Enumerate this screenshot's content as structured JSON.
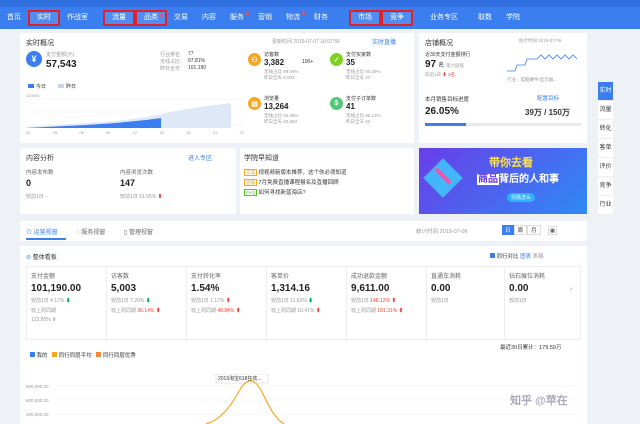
{
  "nav": {
    "items": [
      "首页",
      "实时",
      "作战室",
      "流量",
      "品类",
      "交易",
      "内容",
      "服务",
      "营销",
      "物流",
      "财务",
      "市场",
      "竞争",
      "业务专区",
      "取数",
      "学院"
    ]
  },
  "realtime": {
    "title": "实时概况",
    "update": "更新时间 2019-07-07 16:07:58",
    "link": "实时直播",
    "pay_label": "支付金额(元)",
    "pay_value": "57,543",
    "rank_label": "行业排名",
    "rank_value": "77",
    "ratio_label": "无线占比",
    "ratio_value": "97.81%",
    "yday_label": "昨日全天",
    "yday_value": "101,190",
    "legend_today": "今日",
    "legend_yday": "昨日",
    "y_top": "120000",
    "x_ticks": [
      "00",
      "03",
      "06",
      "09",
      "12",
      "15",
      "18",
      "21",
      "23"
    ],
    "metrics": [
      {
        "label": "访客数",
        "value": "3,382",
        "rank": "100+",
        "ratio_label": "无线占比",
        "ratio": "89.59%",
        "yday_label": "昨日全天",
        "yday": "5,003",
        "icon": "visitor-icon",
        "color": "#f5a623",
        "glyph": "⚇"
      },
      {
        "label": "支付买家数",
        "value": "35",
        "rank": "",
        "ratio_label": "无线占比",
        "ratio": "94.29%",
        "yday_label": "昨日全天",
        "yday": "47",
        "icon": "buyer-icon",
        "color": "#7ed321",
        "glyph": "✓"
      },
      {
        "label": "浏览量",
        "value": "13,264",
        "rank": "",
        "ratio_label": "无线占比",
        "ratio": "94.35%",
        "yday_label": "昨日全天",
        "yday": "20,663",
        "icon": "pageview-icon",
        "color": "#f5a623",
        "glyph": "▤"
      },
      {
        "label": "支付子订单数",
        "value": "41",
        "rank": "",
        "ratio_label": "无线占比",
        "ratio": "95.12%",
        "yday_label": "昨日全天",
        "yday": "52",
        "icon": "order-icon",
        "color": "#50c878",
        "glyph": "$"
      }
    ]
  },
  "shop": {
    "title": "店铺概况",
    "stat_time": "统计时间 2019-07-06",
    "rank_label": "近30天支付金额排行",
    "rank_value": "97",
    "rank_unit": "名",
    "rank_sub": "第六层级",
    "rank_change_label": "较前1日",
    "rank_change": "2名",
    "industry_label": "行业：电脑硬件/显示器...",
    "goal_label": "本月销售目标进度",
    "goal_link": "配置目标",
    "goal_pct": "26.05%",
    "goal_progress": 0.2605,
    "goal_amount": "39万 / 150万"
  },
  "content": {
    "title": "内容分析",
    "link": "进入专区",
    "posts_label": "内容发布数",
    "posts_value": "0",
    "posts_change_label": "较前1日",
    "posts_change": "-",
    "browse_label": "内容浏览次数",
    "browse_value": "147",
    "browse_change_label": "较前1日",
    "browse_change": "51.55%"
  },
  "academy": {
    "title": "学院早知道",
    "items": [
      {
        "tag": "实操",
        "text": "视视频新版本推荐，这个你必须知道"
      },
      {
        "tag": "直播",
        "text": "7月免费直播课程报名及直播回顾"
      },
      {
        "tag": "FAQ",
        "text": "如何寻找新蓝海店?"
      }
    ]
  },
  "banner": {
    "line1": "带你去看",
    "line2a": "商品",
    "line2b": "背后的人和事",
    "btn": "你猜怎么"
  },
  "tabs": {
    "items": [
      "运营视窗",
      "服务视窗",
      "管理视窗"
    ],
    "stat_time": "统计时间 2019-07-06",
    "periods": [
      "日",
      "周",
      "月"
    ]
  },
  "board": {
    "title": "整体看板",
    "compare_label": "同行对比",
    "view1": "图表",
    "view2": "表格",
    "kpis": [
      {
        "label": "支付金额",
        "value": "101,190.00",
        "d1_label": "较前1日",
        "d1": "4.17%",
        "d1_dir": "down",
        "w_label": "较上周同期",
        "w": "123.85%",
        "w_dir": "up"
      },
      {
        "label": "访客数",
        "value": "5,003",
        "d1_label": "较前1日",
        "d1": "7.20%",
        "d1_dir": "down",
        "w_label": "较上周同期",
        "w": "36.14%",
        "w_dir": "up"
      },
      {
        "label": "支付转化率",
        "value": "1.54%",
        "d1_label": "较前1日",
        "d1": "1.17%",
        "d1_dir": "up",
        "w_label": "较上周同期",
        "w": "48.84%",
        "w_dir": "up"
      },
      {
        "label": "客单价",
        "value": "1,314.16",
        "d1_label": "较前1日",
        "d1": "11.63%",
        "d1_dir": "down",
        "w_label": "较上周同期",
        "w": "10.47%",
        "w_dir": "up"
      },
      {
        "label": "成功退款金额",
        "value": "9,611.00",
        "d1_label": "较前1日",
        "d1": "148.12%",
        "d1_dir": "up",
        "w_label": "较上周同期",
        "w": "181.31%",
        "w_dir": "up"
      },
      {
        "label": "直通车消耗",
        "value": "0.00",
        "d1_label": "较前1日",
        "d1": "",
        "d1_dir": "",
        "w_label": "",
        "w": "",
        "w_dir": ""
      },
      {
        "label": "钻石展位消耗",
        "value": "0.00",
        "d1_label": "较前1日",
        "d1": "",
        "d1_dir": "",
        "w_label": "",
        "w": "",
        "w_dir": ""
      }
    ],
    "cumulative": "最近30日累计：179.59万"
  },
  "trend": {
    "legend": [
      {
        "name": "我的",
        "color": "#3a7ef0"
      },
      {
        "name": "同行同层平均",
        "color": "#f5a623"
      },
      {
        "name": "同行同层优秀",
        "color": "#f08a3c"
      }
    ],
    "y_labels": [
      "800,000.00",
      "600,000.00",
      "400,000.00"
    ],
    "annotation": "2019淘宝618狂欢...",
    "watermark": "知乎 @苹在"
  },
  "sidebar": {
    "items": [
      "实时",
      "流量",
      "转化",
      "客单",
      "评价",
      "竞争",
      "行业"
    ]
  },
  "colors": {
    "nav": "#3a7ef0",
    "highlight": "#e0202a",
    "accent": "#3a7ef0",
    "up": "#f04134",
    "down": "#00a854"
  }
}
